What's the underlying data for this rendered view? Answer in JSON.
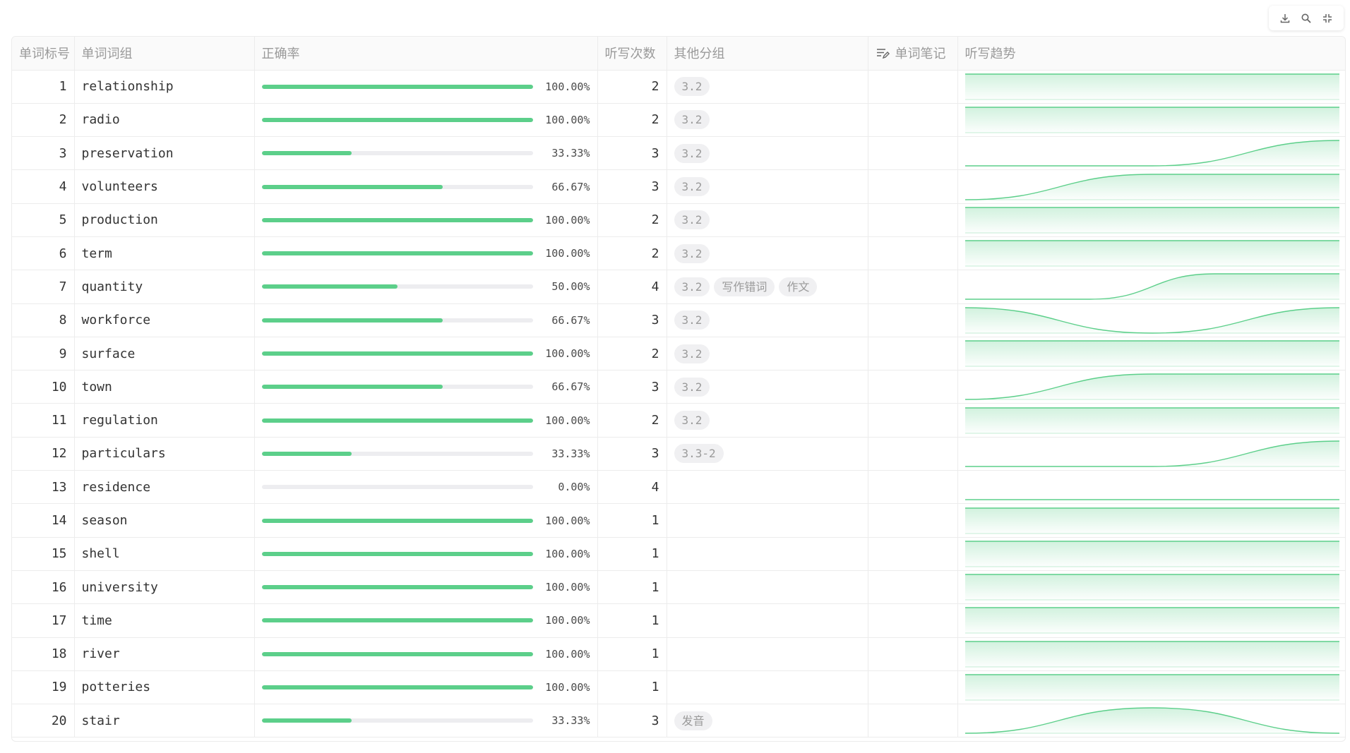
{
  "toolbar": {
    "download_icon": "download-icon",
    "search_icon": "search-icon",
    "collapse_icon": "collapse-icon"
  },
  "columns": {
    "id": "单词标号",
    "word": "单词词组",
    "rate": "正确率",
    "count": "听写次数",
    "groups": "其他分组",
    "notes": "单词笔记",
    "trend": "听写趋势"
  },
  "accent_color": "#5ccf8a",
  "rows": [
    {
      "id": "1",
      "word": "relationship",
      "rate": 1.0,
      "rate_text": "100.00%",
      "count": "2",
      "tags": [
        "3.2"
      ],
      "trend": [
        1,
        1
      ]
    },
    {
      "id": "2",
      "word": "radio",
      "rate": 1.0,
      "rate_text": "100.00%",
      "count": "2",
      "tags": [
        "3.2"
      ],
      "trend": [
        1,
        1
      ]
    },
    {
      "id": "3",
      "word": "preservation",
      "rate": 0.3333,
      "rate_text": "33.33%",
      "count": "3",
      "tags": [
        "3.2"
      ],
      "trend": [
        0,
        0,
        1
      ]
    },
    {
      "id": "4",
      "word": "volunteers",
      "rate": 0.6667,
      "rate_text": "66.67%",
      "count": "3",
      "tags": [
        "3.2"
      ],
      "trend": [
        0,
        1,
        1
      ]
    },
    {
      "id": "5",
      "word": "production",
      "rate": 1.0,
      "rate_text": "100.00%",
      "count": "2",
      "tags": [
        "3.2"
      ],
      "trend": [
        1,
        1
      ]
    },
    {
      "id": "6",
      "word": "term",
      "rate": 1.0,
      "rate_text": "100.00%",
      "count": "2",
      "tags": [
        "3.2"
      ],
      "trend": [
        1,
        1
      ]
    },
    {
      "id": "7",
      "word": "quantity",
      "rate": 0.5,
      "rate_text": "50.00%",
      "count": "4",
      "tags": [
        "3.2",
        "写作错词",
        "作文"
      ],
      "trend": [
        0,
        0,
        1,
        1
      ]
    },
    {
      "id": "8",
      "word": "workforce",
      "rate": 0.6667,
      "rate_text": "66.67%",
      "count": "3",
      "tags": [
        "3.2"
      ],
      "trend": [
        1,
        0,
        1
      ]
    },
    {
      "id": "9",
      "word": "surface",
      "rate": 1.0,
      "rate_text": "100.00%",
      "count": "2",
      "tags": [
        "3.2"
      ],
      "trend": [
        1,
        1
      ]
    },
    {
      "id": "10",
      "word": "town",
      "rate": 0.6667,
      "rate_text": "66.67%",
      "count": "3",
      "tags": [
        "3.2"
      ],
      "trend": [
        0,
        1,
        1
      ]
    },
    {
      "id": "11",
      "word": "regulation",
      "rate": 1.0,
      "rate_text": "100.00%",
      "count": "2",
      "tags": [
        "3.2"
      ],
      "trend": [
        1,
        1
      ]
    },
    {
      "id": "12",
      "word": "particulars",
      "rate": 0.3333,
      "rate_text": "33.33%",
      "count": "3",
      "tags": [
        "3.3-2"
      ],
      "trend": [
        0,
        0,
        1
      ]
    },
    {
      "id": "13",
      "word": "residence",
      "rate": 0.0,
      "rate_text": "0.00%",
      "count": "4",
      "tags": [],
      "trend": [
        0,
        0,
        0,
        0
      ]
    },
    {
      "id": "14",
      "word": "season",
      "rate": 1.0,
      "rate_text": "100.00%",
      "count": "1",
      "tags": [],
      "trend": [
        1
      ]
    },
    {
      "id": "15",
      "word": "shell",
      "rate": 1.0,
      "rate_text": "100.00%",
      "count": "1",
      "tags": [],
      "trend": [
        1
      ]
    },
    {
      "id": "16",
      "word": "university",
      "rate": 1.0,
      "rate_text": "100.00%",
      "count": "1",
      "tags": [],
      "trend": [
        1
      ]
    },
    {
      "id": "17",
      "word": "time",
      "rate": 1.0,
      "rate_text": "100.00%",
      "count": "1",
      "tags": [],
      "trend": [
        1
      ]
    },
    {
      "id": "18",
      "word": "river",
      "rate": 1.0,
      "rate_text": "100.00%",
      "count": "1",
      "tags": [],
      "trend": [
        1
      ]
    },
    {
      "id": "19",
      "word": "potteries",
      "rate": 1.0,
      "rate_text": "100.00%",
      "count": "1",
      "tags": [],
      "trend": [
        1
      ]
    },
    {
      "id": "20",
      "word": "stair",
      "rate": 0.3333,
      "rate_text": "33.33%",
      "count": "3",
      "tags": [
        "发音"
      ],
      "trend": [
        0,
        1,
        0
      ]
    }
  ]
}
